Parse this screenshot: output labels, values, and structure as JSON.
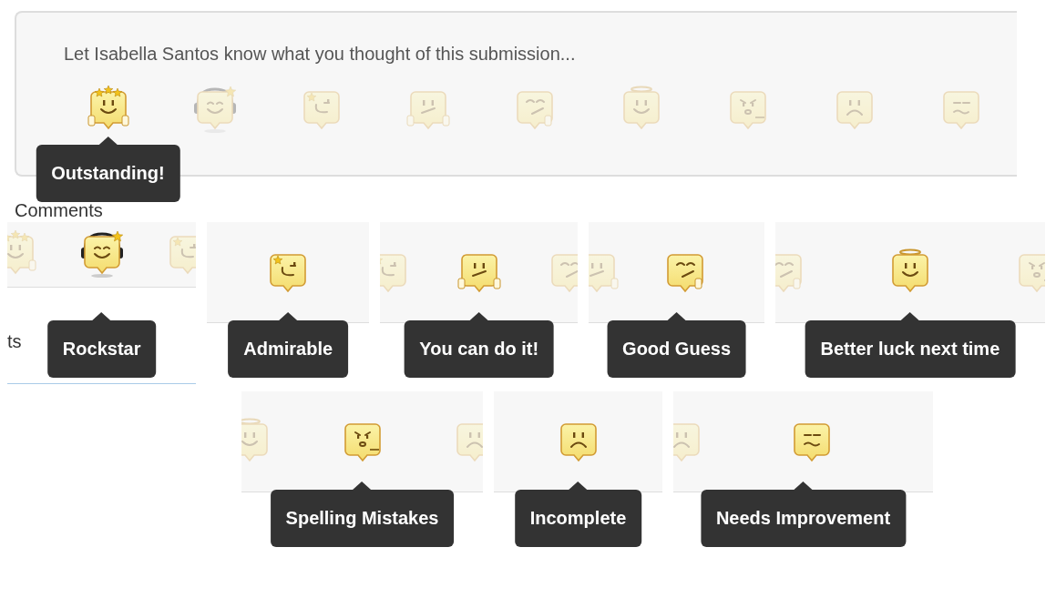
{
  "feedback_panel": {
    "prompt": "Let Isabella Santos know what you thought of this submission...",
    "badges": [
      {
        "kind": "outstanding",
        "selected": true
      },
      {
        "kind": "rockstar",
        "selected": false
      },
      {
        "kind": "admirable",
        "selected": false
      },
      {
        "kind": "youcan",
        "selected": false
      },
      {
        "kind": "goodguess",
        "selected": false
      },
      {
        "kind": "betterluck",
        "selected": false
      },
      {
        "kind": "spelling",
        "selected": false
      },
      {
        "kind": "incomplete",
        "selected": false
      },
      {
        "kind": "needsimprovement",
        "selected": false
      }
    ],
    "tooltip": "Outstanding!"
  },
  "comments_heading": "Comments",
  "snippets": [
    {
      "icons": [
        {
          "kind": "outstanding",
          "selected": false
        },
        {
          "kind": "rockstar",
          "selected": true
        },
        {
          "kind": "admirable",
          "selected": false
        }
      ],
      "tooltip": "Rockstar",
      "fragment_text": "ts"
    },
    {
      "icons": [
        {
          "kind": "admirable",
          "selected": true
        }
      ],
      "tooltip": "Admirable"
    },
    {
      "icons": [
        {
          "kind": "admirable",
          "selected": false
        },
        {
          "kind": "youcan",
          "selected": true
        },
        {
          "kind": "goodguess",
          "selected": false
        }
      ],
      "tooltip": "You can do it!"
    },
    {
      "icons": [
        {
          "kind": "youcan",
          "selected": false
        },
        {
          "kind": "goodguess",
          "selected": true
        }
      ],
      "tooltip": "Good Guess"
    },
    {
      "icons": [
        {
          "kind": "goodguess",
          "selected": false
        },
        {
          "kind": "betterluck",
          "selected": true
        },
        {
          "kind": "spelling",
          "selected": false
        }
      ],
      "tooltip": "Better luck next time"
    },
    {
      "icons": [
        {
          "kind": "betterluck",
          "selected": false
        },
        {
          "kind": "spelling",
          "selected": true
        },
        {
          "kind": "incomplete",
          "selected": false
        }
      ],
      "tooltip": "Spelling Mistakes"
    },
    {
      "icons": [
        {
          "kind": "incomplete",
          "selected": true
        }
      ],
      "tooltip": "Incomplete"
    },
    {
      "icons": [
        {
          "kind": "incomplete",
          "selected": false
        },
        {
          "kind": "needsimprovement",
          "selected": true
        }
      ],
      "tooltip": "Needs Improvement"
    }
  ]
}
